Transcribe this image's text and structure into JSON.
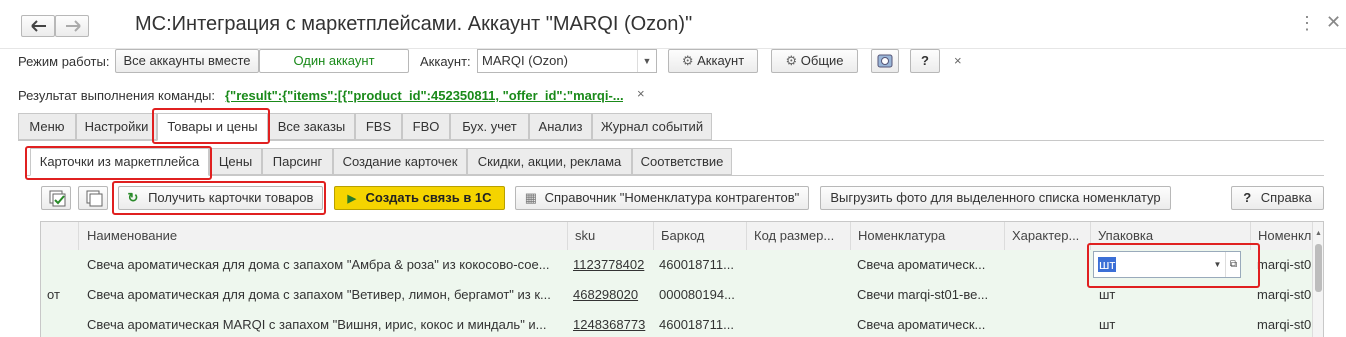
{
  "title": "МС:Интеграция с маркетплейсами. Аккаунт \"MARQI (Ozon)\"",
  "mode_label": "Режим работы:",
  "mode_options": [
    "Все аккаунты вместе",
    "Один аккаунт"
  ],
  "account_label": "Аккаунт:",
  "account_value": "MARQI (Ozon)",
  "account_button": "Аккаунт",
  "general_button": "Общие",
  "help_q": "?",
  "close_x": "×",
  "result_label": "Результат выполнения команды:",
  "result_value": "{\"result\":{\"items\":[{\"product_id\":452350811, \"offer_id\":\"marqi-...",
  "main_tabs": [
    "Меню",
    "Настройки",
    "Товары и цены",
    "Все заказы",
    "FBS",
    "FBO",
    "Бух. учет",
    "Анализ",
    "Журнал событий"
  ],
  "sub_tabs": [
    "Карточки из маркетплейса",
    "Цены",
    "Парсинг",
    "Создание карточек",
    "Скидки, акции, реклама",
    "Соответствие"
  ],
  "toolbar": {
    "get_cards": "Получить карточки товаров",
    "create_link": "Создать связь в 1С",
    "directory": "Справочник \"Номенклатура контрагентов\"",
    "upload_photo": "Выгрузить фото для выделенного списка номенклатур",
    "help": "Справка"
  },
  "columns": [
    "Наименование",
    "sku",
    "Баркод",
    "Код размер...",
    "Номенклатура",
    "Характер...",
    "Упаковка",
    "Номенкл"
  ],
  "rows": [
    {
      "pre": "",
      "name": "Свеча ароматическая для дома с запахом \"Амбра & роза\" из кокосово-сое...",
      "sku": "1123778402",
      "barcode": "460018711...",
      "size": "",
      "nomen": "Свеча ароматическ...",
      "char": "",
      "pack": "шт",
      "nomen2": "marqi-st0"
    },
    {
      "pre": "от",
      "name": "Свеча ароматическая для дома с запахом \"Ветивер, лимон, бергамот\" из к...",
      "sku": "468298020",
      "barcode": "000080194...",
      "size": "",
      "nomen": "Свечи marqi-st01-ве...",
      "char": "",
      "pack": "шт",
      "nomen2": "marqi-st0"
    },
    {
      "pre": "",
      "name": "Свеча ароматическая MARQI с запахом \"Вишня, ирис, кокос и миндаль\" и...",
      "sku": "1248368773",
      "barcode": "460018711...",
      "size": "",
      "nomen": "Свеча ароматическ...",
      "char": "",
      "pack": "шт",
      "nomen2": "marqi-st0"
    }
  ],
  "colors": {
    "accent_red": "#e02020",
    "create_btn": "#f5d400",
    "link_green": "#1a8a1a",
    "grid_bg": "#eef7ee"
  }
}
